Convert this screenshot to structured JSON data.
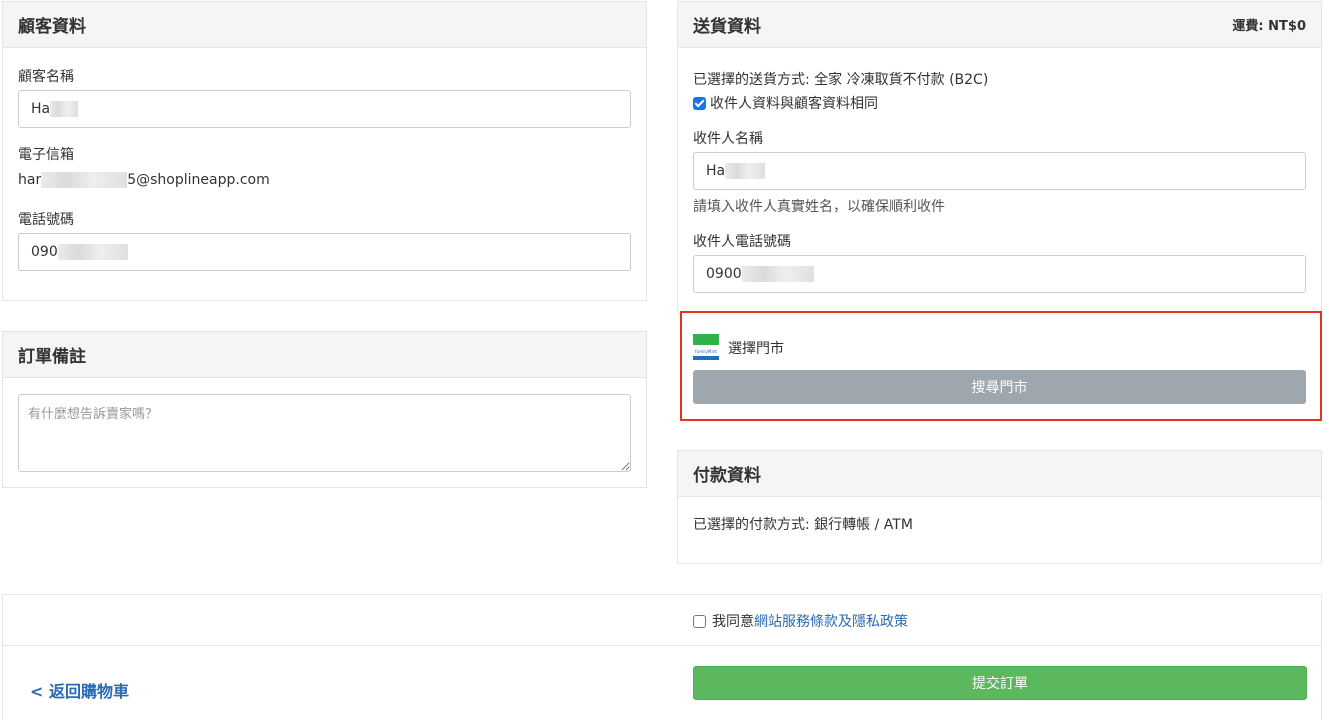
{
  "customer": {
    "title": "顧客資料",
    "name_label": "顧客名稱",
    "name_value": "Ha",
    "email_label": "電子信箱",
    "email_prefix": "har",
    "email_suffix": "5@shoplineapp.com",
    "phone_label": "電話號碼",
    "phone_value": "090"
  },
  "order_note": {
    "title": "訂單備註",
    "placeholder": "有什麼想告訴賣家嗎？"
  },
  "delivery": {
    "title": "送貨資料",
    "fee_text": "運費: NT$0",
    "method_text": "已選擇的送貨方式: 全家 冷凍取貨不付款 (B2C)",
    "same_as_customer_label": "收件人資料與顧客資料相同",
    "same_as_customer_checked": true,
    "recipient_name_label": "收件人名稱",
    "recipient_name_value": "Ha",
    "recipient_name_help": "請填入收件人真實姓名，以確保順利收件",
    "recipient_phone_label": "收件人電話號碼",
    "recipient_phone_value": "0900",
    "store_logo_text": "FamilyMart",
    "select_store_label": "選擇門市",
    "search_store_button": "搜尋門市"
  },
  "payment": {
    "title": "付款資料",
    "method_text": "已選擇的付款方式: 銀行轉帳 / ATM"
  },
  "footer": {
    "agree_prefix": "我同意",
    "agree_link": "網站服務條款及隱私政策",
    "back_link": "< 返回購物車",
    "submit_button": "提交訂單"
  },
  "colors": {
    "highlight_border": "#e5331f",
    "submit_green": "#5cb85c",
    "search_button_gray": "#9ea7ad",
    "link_blue": "#2b6cb0"
  }
}
